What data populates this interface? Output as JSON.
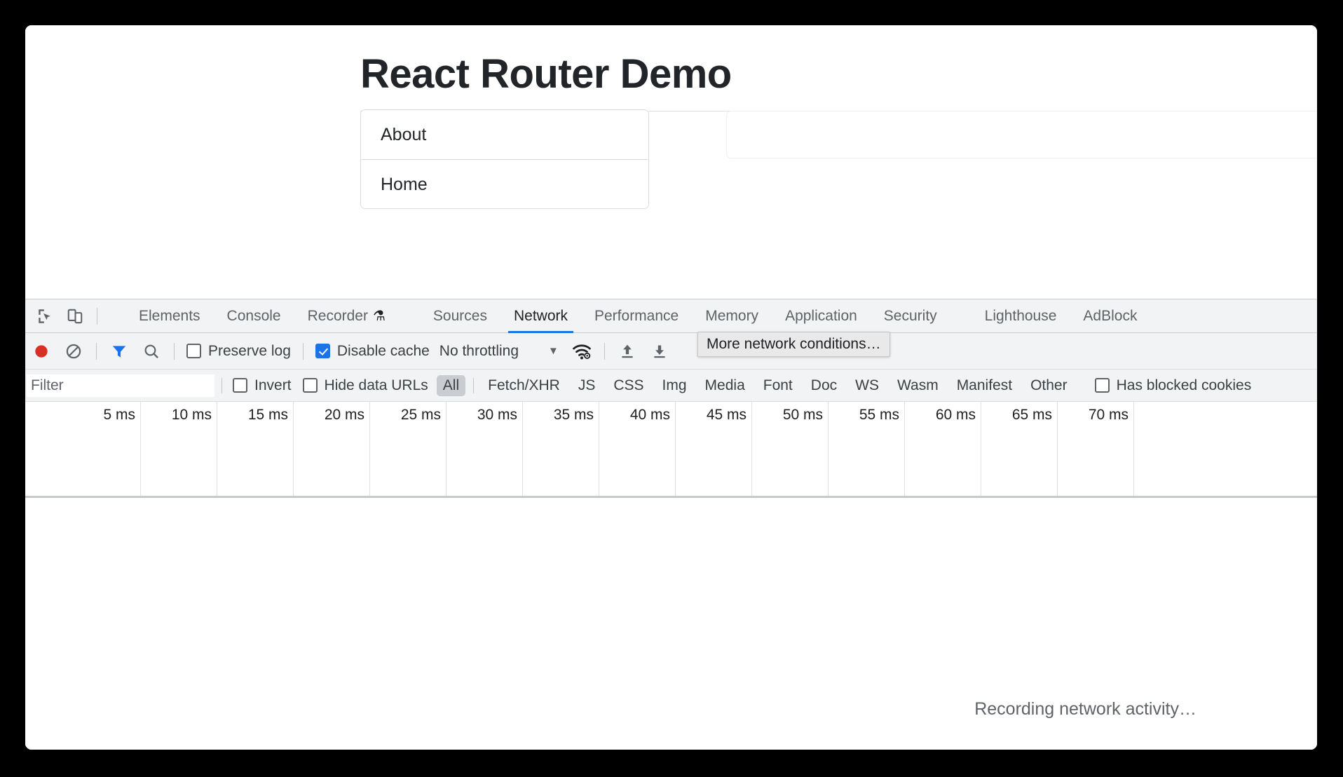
{
  "page": {
    "title": "React Router Demo",
    "nav_items": [
      {
        "label": "About"
      },
      {
        "label": "Home"
      }
    ],
    "content_card_text": ""
  },
  "devtools": {
    "left_icons": [
      {
        "name": "inspect-element-icon"
      },
      {
        "name": "device-toolbar-icon"
      }
    ],
    "tabs": [
      {
        "label": "Elements",
        "selected": false,
        "badge": ""
      },
      {
        "label": "Console",
        "selected": false,
        "badge": ""
      },
      {
        "label": "Recorder",
        "selected": false,
        "badge": "⚗"
      },
      {
        "label": "Sources",
        "selected": false,
        "badge": ""
      },
      {
        "label": "Network",
        "selected": true,
        "badge": ""
      },
      {
        "label": "Performance",
        "selected": false,
        "badge": ""
      },
      {
        "label": "Memory",
        "selected": false,
        "badge": ""
      },
      {
        "label": "Application",
        "selected": false,
        "badge": ""
      },
      {
        "label": "Security",
        "selected": false,
        "badge": ""
      },
      {
        "label": "Lighthouse",
        "selected": false,
        "badge": ""
      },
      {
        "label": "AdBlock",
        "selected": false,
        "badge": ""
      }
    ],
    "toolbar": {
      "record_title": "Stop recording network log",
      "clear_title": "Clear network log",
      "filter_title": "Filter",
      "search_title": "Search",
      "preserve_log_label": "Preserve log",
      "preserve_log_checked": false,
      "disable_cache_label": "Disable cache",
      "disable_cache_checked": true,
      "throttling_value": "No throttling",
      "throttling_caret": "▼",
      "network_conditions_title": "More network conditions…",
      "import_har_title": "Import HAR file",
      "export_har_title": "Export HAR file"
    },
    "filter_bar": {
      "filter_placeholder": "Filter",
      "filter_value": "",
      "invert_label": "Invert",
      "invert_checked": false,
      "hide_data_urls_label": "Hide data URLs",
      "hide_data_urls_checked": false,
      "type_chips": [
        {
          "label": "All",
          "active": true
        },
        {
          "label": "Fetch/XHR",
          "active": false
        },
        {
          "label": "JS",
          "active": false
        },
        {
          "label": "CSS",
          "active": false
        },
        {
          "label": "Img",
          "active": false
        },
        {
          "label": "Media",
          "active": false
        },
        {
          "label": "Font",
          "active": false
        },
        {
          "label": "Doc",
          "active": false
        },
        {
          "label": "WS",
          "active": false
        },
        {
          "label": "Wasm",
          "active": false
        },
        {
          "label": "Manifest",
          "active": false
        },
        {
          "label": "Other",
          "active": false
        }
      ],
      "has_blocked_cookies_label": "Has blocked cookies",
      "has_blocked_cookies_checked": false
    },
    "tooltip": {
      "text": "More network conditions…"
    },
    "timeline": {
      "ticks": [
        "5 ms",
        "10 ms",
        "15 ms",
        "20 ms",
        "25 ms",
        "30 ms",
        "35 ms",
        "40 ms",
        "45 ms",
        "50 ms",
        "55 ms",
        "60 ms",
        "65 ms",
        "70 ms"
      ]
    },
    "results": {
      "status_text": "Recording network activity…"
    }
  },
  "colors": {
    "accent": "#1a73e8",
    "record_active": "#d93025",
    "toolbar_bg": "#f1f3f4",
    "text": "#3c4043"
  }
}
